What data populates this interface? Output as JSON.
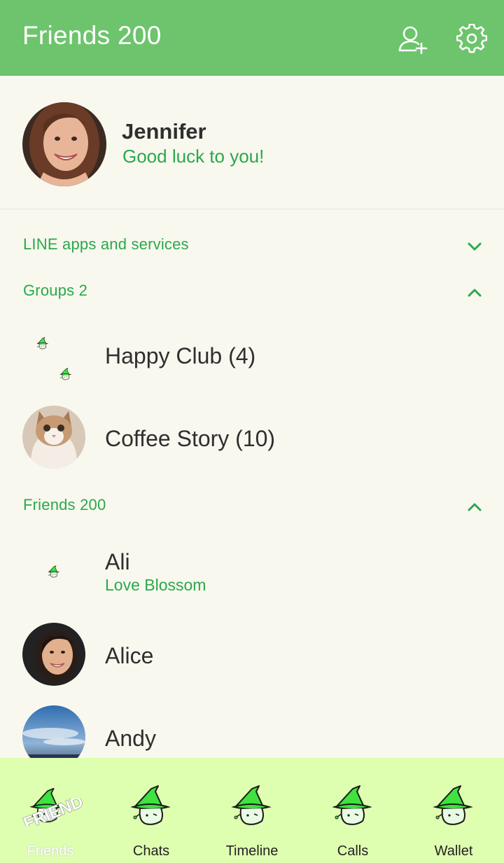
{
  "header": {
    "title": "Friends 200",
    "add_friend_icon": "add-friend-icon",
    "settings_icon": "gear-icon",
    "bg_color": "#6dc46d"
  },
  "profile": {
    "name": "Jennifer",
    "status": "Good luck to you!"
  },
  "sections": {
    "line_apps": "LINE apps and services",
    "groups": "Groups 2",
    "friends": "Friends 200"
  },
  "groups": [
    {
      "name": "Happy Club (4)"
    },
    {
      "name": "Coffee Story (10)"
    }
  ],
  "friends": [
    {
      "name": "Ali",
      "status": "Love Blossom"
    },
    {
      "name": "Alice"
    },
    {
      "name": "Andy"
    }
  ],
  "tabs": [
    {
      "label": "Friends",
      "stamp": "FRIEND"
    },
    {
      "label": "Chats"
    },
    {
      "label": "Timeline"
    },
    {
      "label": "Calls"
    },
    {
      "label": "Wallet"
    }
  ],
  "colors": {
    "accent": "#2aa84c",
    "tabbar": "#dfffb0",
    "background": "#f8f8ee"
  }
}
